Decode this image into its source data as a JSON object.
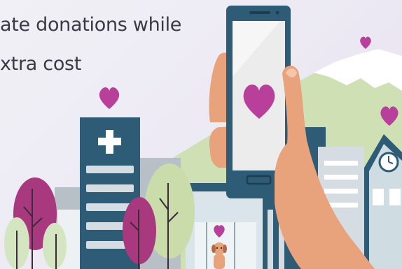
{
  "text": {
    "line1": "ate donations while",
    "line2": "xtra cost"
  },
  "colors": {
    "background": "#eeebf3",
    "navy": "#2e5b76",
    "heart": "#b8409a",
    "screen": "#ececec",
    "skin": "#e8a27c",
    "mountain": "#cfe0b5",
    "snow": "#ffffff",
    "tree_light": "#c9dcaa",
    "tree_magenta": "#a9397f",
    "building_light": "#d6dde2",
    "building_grey": "#9aa6ad"
  },
  "icons": {
    "hospital_cross": "medical-cross-icon",
    "heart": "heart-icon",
    "clock": "clock-icon"
  }
}
